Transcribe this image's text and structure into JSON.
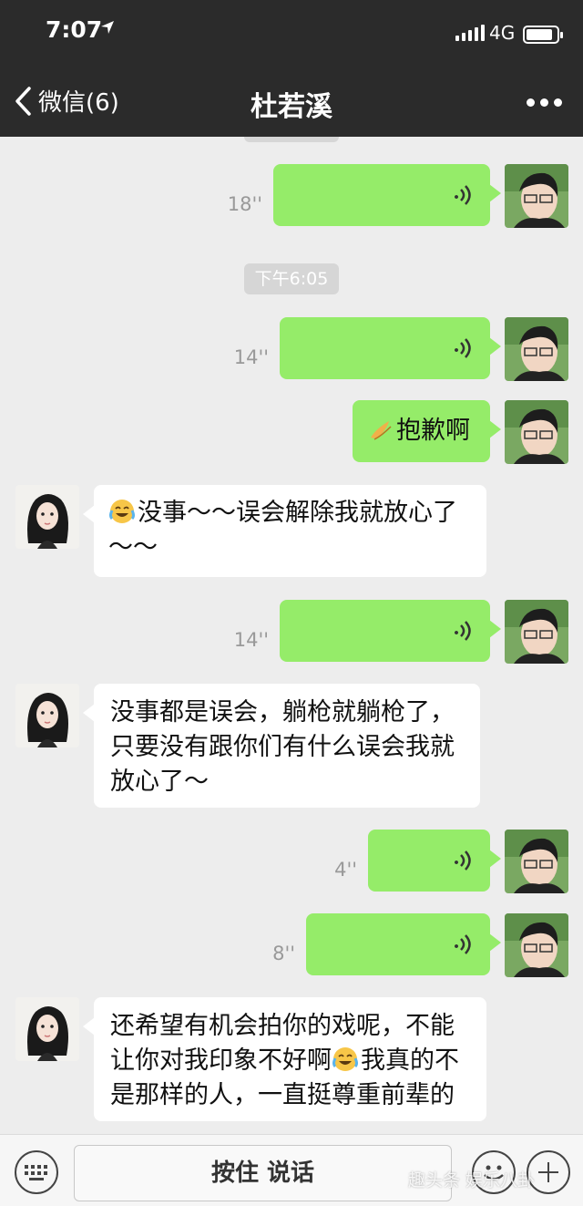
{
  "status_bar": {
    "time": "7:07",
    "network": "4G",
    "icons": [
      "location-arrow-icon",
      "signal-icon",
      "battery-icon"
    ]
  },
  "nav": {
    "back_label": "微信(6)",
    "title": "杜若溪",
    "more_icon": "more-dots-icon"
  },
  "colors": {
    "topbar": "#2b2b2b",
    "chat_bg": "#ededed",
    "sent_bubble": "#95ec69",
    "received_bubble": "#ffffff",
    "timestamp_bg": "#d6d6d6"
  },
  "chat": {
    "timestamp": "下午6:05",
    "messages": [
      {
        "side": "sent",
        "kind": "voice",
        "duration": "18''"
      },
      {
        "side": "sent",
        "kind": "voice",
        "duration": "14''"
      },
      {
        "side": "sent",
        "kind": "text",
        "text": "抱歉啊",
        "emoji": "clasped-hands-emoji"
      },
      {
        "side": "received",
        "kind": "text",
        "lines": [
          "没事～～误会解除我就放心了",
          "～～"
        ],
        "emoji": "crying-laughing-emoji"
      },
      {
        "side": "sent",
        "kind": "voice",
        "duration": "14''"
      },
      {
        "side": "received",
        "kind": "text",
        "lines": [
          "没事都是误会，躺枪就躺枪了，",
          "只要没有跟你们有什么误会我就",
          "放心了～"
        ]
      },
      {
        "side": "sent",
        "kind": "voice",
        "duration": "4''"
      },
      {
        "side": "sent",
        "kind": "voice",
        "duration": "8''"
      },
      {
        "side": "received",
        "kind": "text",
        "lines": [
          "还希望有机会拍你的戏呢，不能",
          "让你对我印象不好啊",
          "我真的不",
          "是那样的人，一直挺尊重前辈的"
        ],
        "emoji": "crying-laughing-emoji"
      }
    ]
  },
  "input_bar": {
    "hold_to_talk": "按住 说话",
    "icons": [
      "keyboard-icon",
      "emoji-face-icon",
      "plus-icon"
    ]
  },
  "watermark": "趣头条 娱乐八卦"
}
